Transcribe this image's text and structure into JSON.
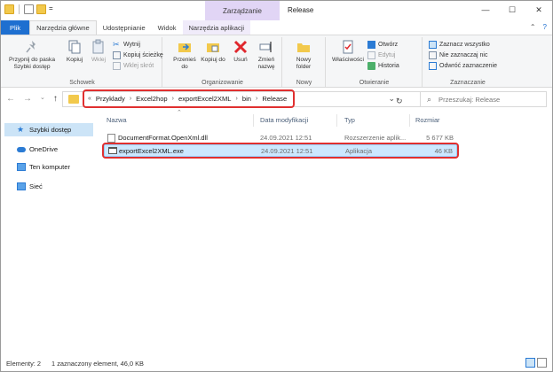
{
  "titlebar": {
    "context_tab": "Zarządzanie",
    "title": "Release",
    "minimize": "—",
    "maximize": "☐",
    "close": "✕"
  },
  "tabs": [
    "Plik",
    "Narzędzia główne",
    "Udostępnianie",
    "Widok",
    "Narzędzia aplikacji"
  ],
  "ribbon": {
    "schowek": {
      "label": "Schowek",
      "pin": "Przypnij do paska Szybki dostęp",
      "copy": "Kopiuj",
      "paste": "Wklej",
      "cut": "Wytnij",
      "copy_path": "Kopiuj ścieżkę",
      "paste_shortcut": "Wklej skrót"
    },
    "organizowanie": {
      "label": "Organizowanie",
      "move_to": "Przenieś do",
      "copy_to": "Kopiuj do",
      "delete": "Usuń",
      "rename": "Zmień nazwę"
    },
    "nowy": {
      "label": "Nowy",
      "new_folder": "Nowy folder"
    },
    "otwieranie": {
      "label": "Otwieranie",
      "properties": "Właściwości",
      "open": "Otwórz",
      "edit": "Edytuj",
      "history": "Historia"
    },
    "zaznaczanie": {
      "label": "Zaznaczanie",
      "select_all": "Zaznacz wszystko",
      "select_none": "Nie zaznaczaj nic",
      "invert": "Odwróć zaznaczenie"
    }
  },
  "address": {
    "crumbs": [
      "Przyklady",
      "Excel2hop",
      "exportExcel2XML",
      "bin",
      "Release"
    ],
    "search_placeholder": "Przeszukaj: Release"
  },
  "sidebar": {
    "items": [
      "Szybki dostęp",
      "OneDrive",
      "Ten komputer",
      "Sieć"
    ]
  },
  "columns": {
    "name": "Nazwa",
    "date": "Data modyfikacji",
    "type": "Typ",
    "size": "Rozmiar"
  },
  "files": [
    {
      "name": "DocumentFormat.OpenXml.dll",
      "date": "24.09.2021 12:51",
      "type": "Rozszerzenie aplik...",
      "size": "5 677 KB"
    },
    {
      "name": "exportExcel2XML.exe",
      "date": "24.09.2021 12:51",
      "type": "Aplikacja",
      "size": "46 KB"
    }
  ],
  "status": {
    "items": "Elementy: 2",
    "selected": "1 zaznaczony element, 46,0 KB"
  },
  "colors": {
    "accent": "#1e6fd0",
    "highlight": "#e03030",
    "selection": "#cce8ff",
    "context_tab": "#e1d5f5"
  }
}
